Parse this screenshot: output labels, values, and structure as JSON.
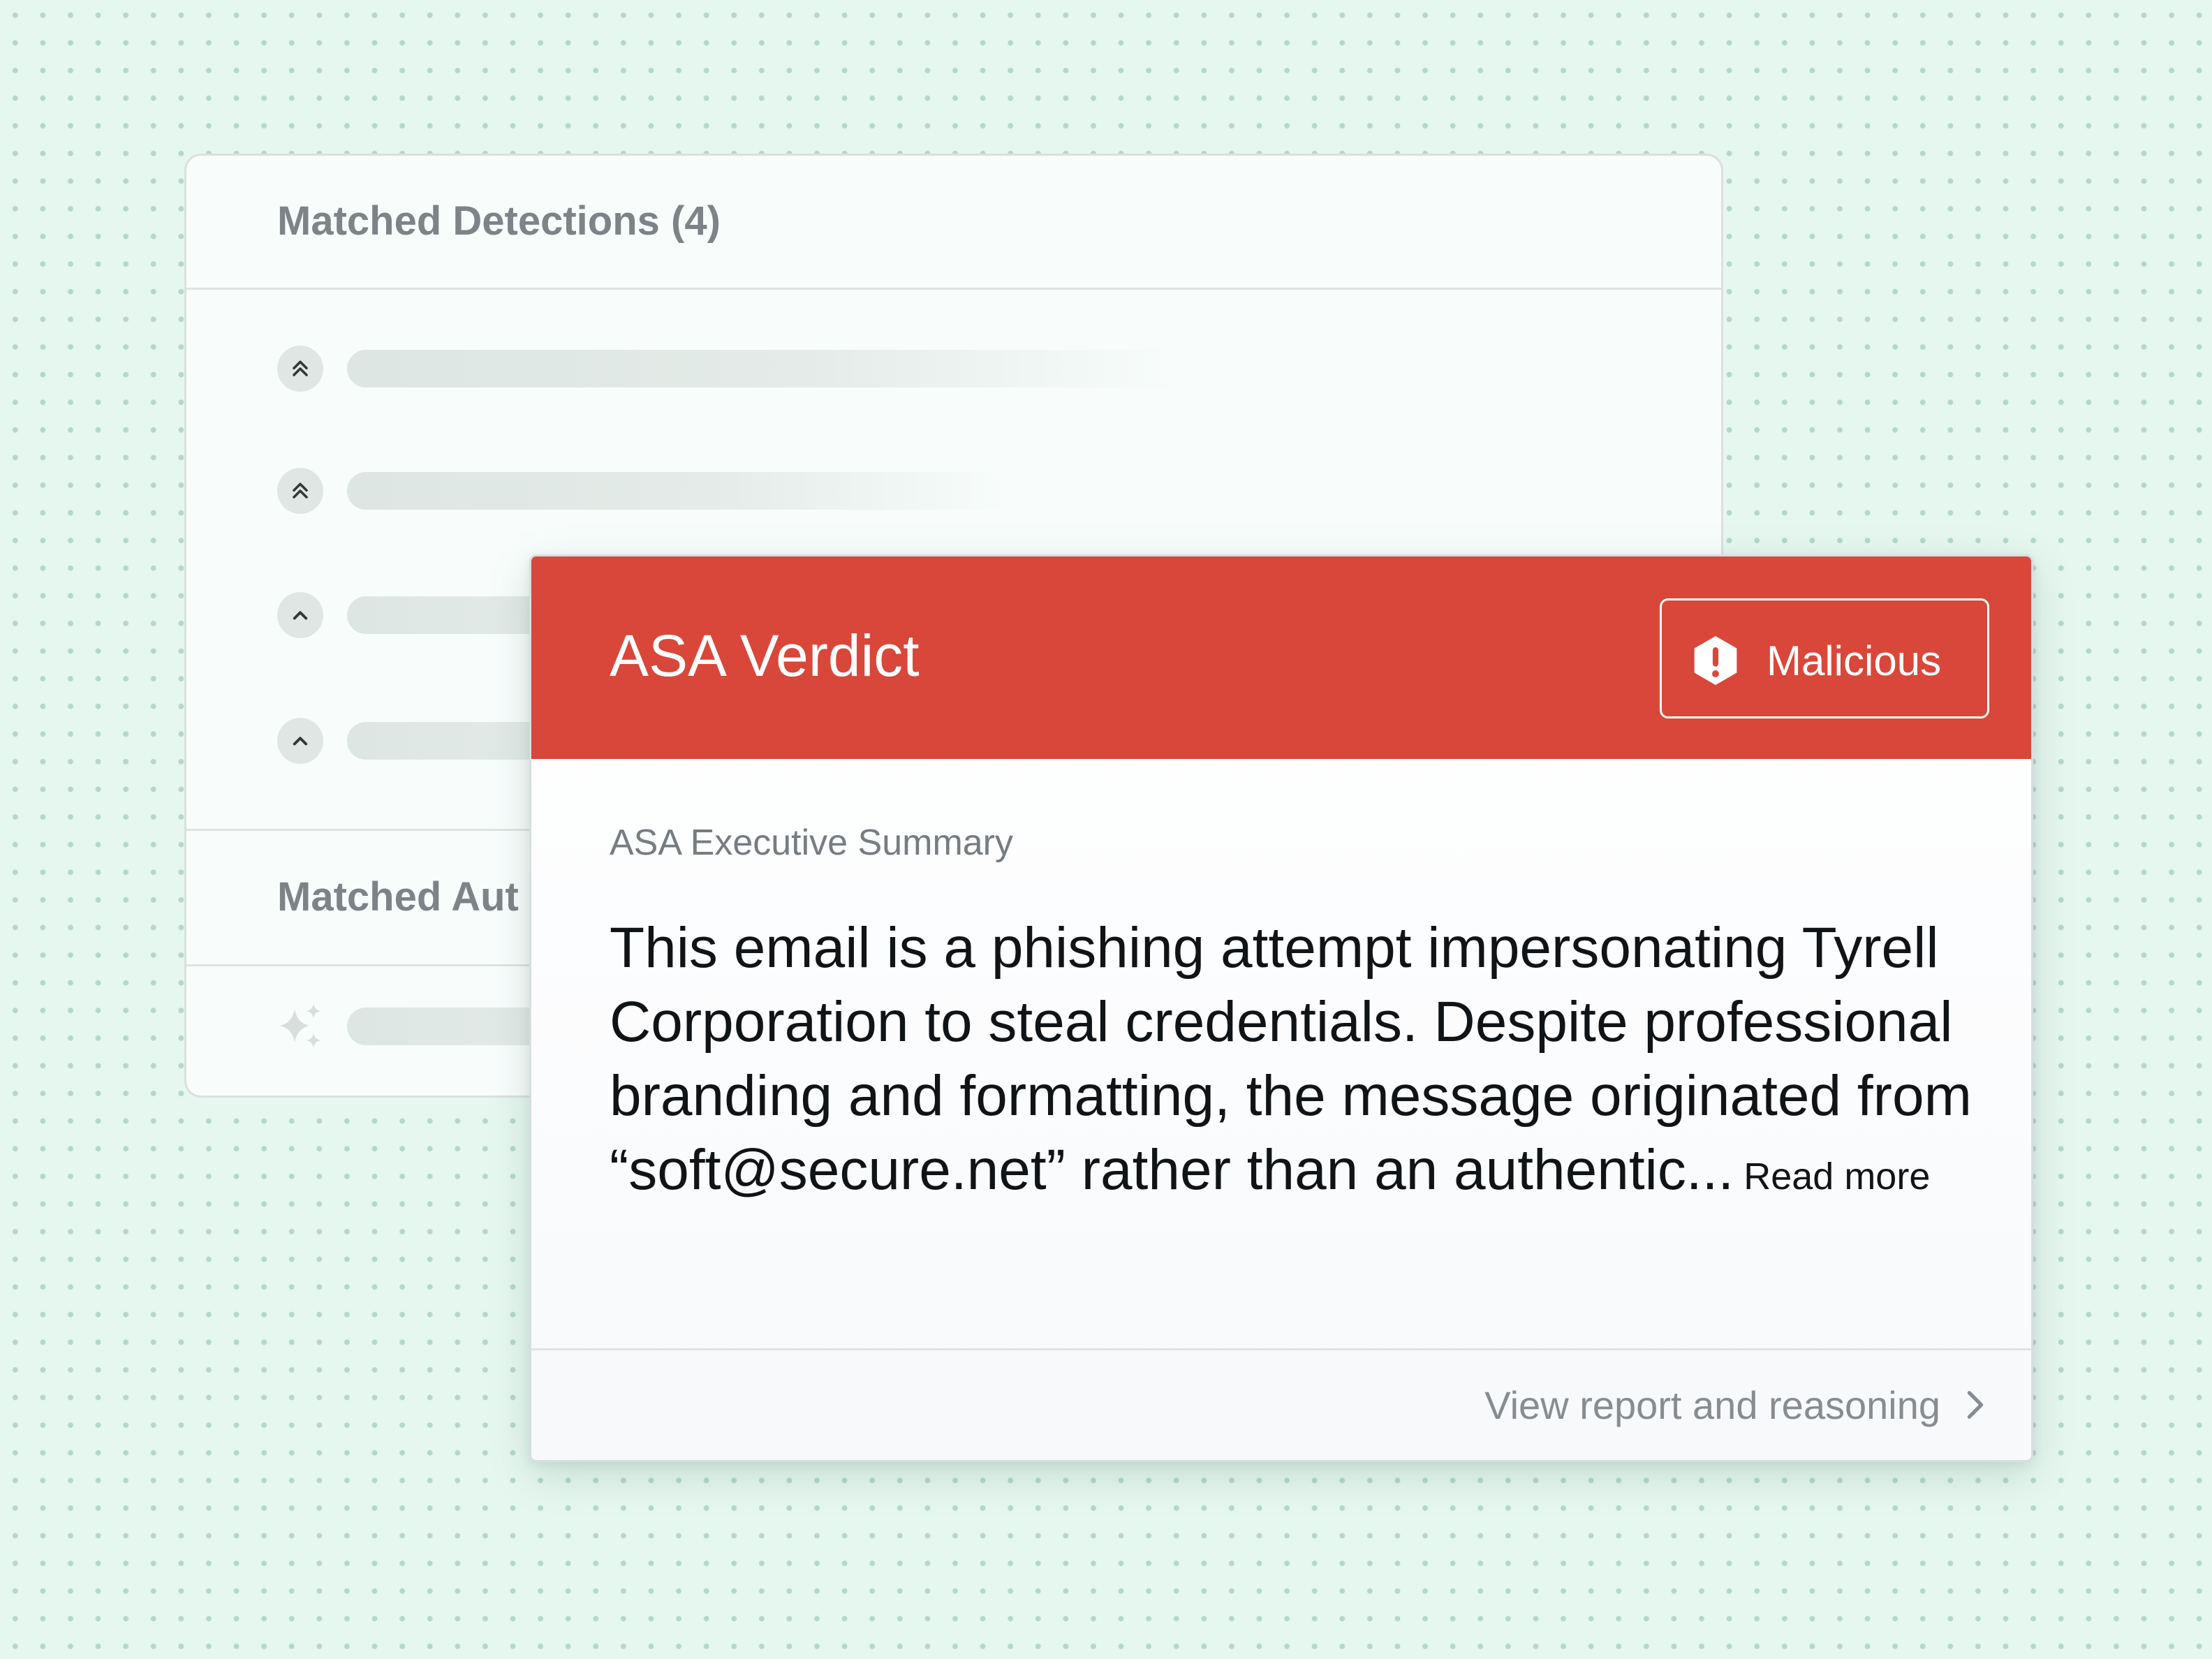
{
  "colors": {
    "background": "#e6f7f0",
    "verdict_red": "#d9473a",
    "panel_background": "#f8fdfc",
    "muted_text": "#7d8387"
  },
  "detections_panel": {
    "title": "Matched Detections (4)",
    "rows": [
      {
        "icon": "double-chevron-up-icon"
      },
      {
        "icon": "double-chevron-up-icon"
      },
      {
        "icon": "chevron-up-icon"
      },
      {
        "icon": "chevron-up-icon"
      }
    ],
    "second_section_title": "Matched Aut",
    "second_section_icon": "sparkle-icon"
  },
  "verdict_card": {
    "title": "ASA Verdict",
    "badge": {
      "label": "Malicious",
      "icon": "alert-hexagon-icon"
    },
    "summary_label": "ASA Executive Summary",
    "summary_text": "This email is a phishing attempt impersonating Tyrell Corporation to steal credentials. Despite professional branding and formatting, the message originated from “soft@secure.net” rather than an authentic...",
    "read_more_label": "Read more",
    "footer_link": {
      "label": "View report and reasoning",
      "icon": "chevron-right-icon"
    }
  }
}
